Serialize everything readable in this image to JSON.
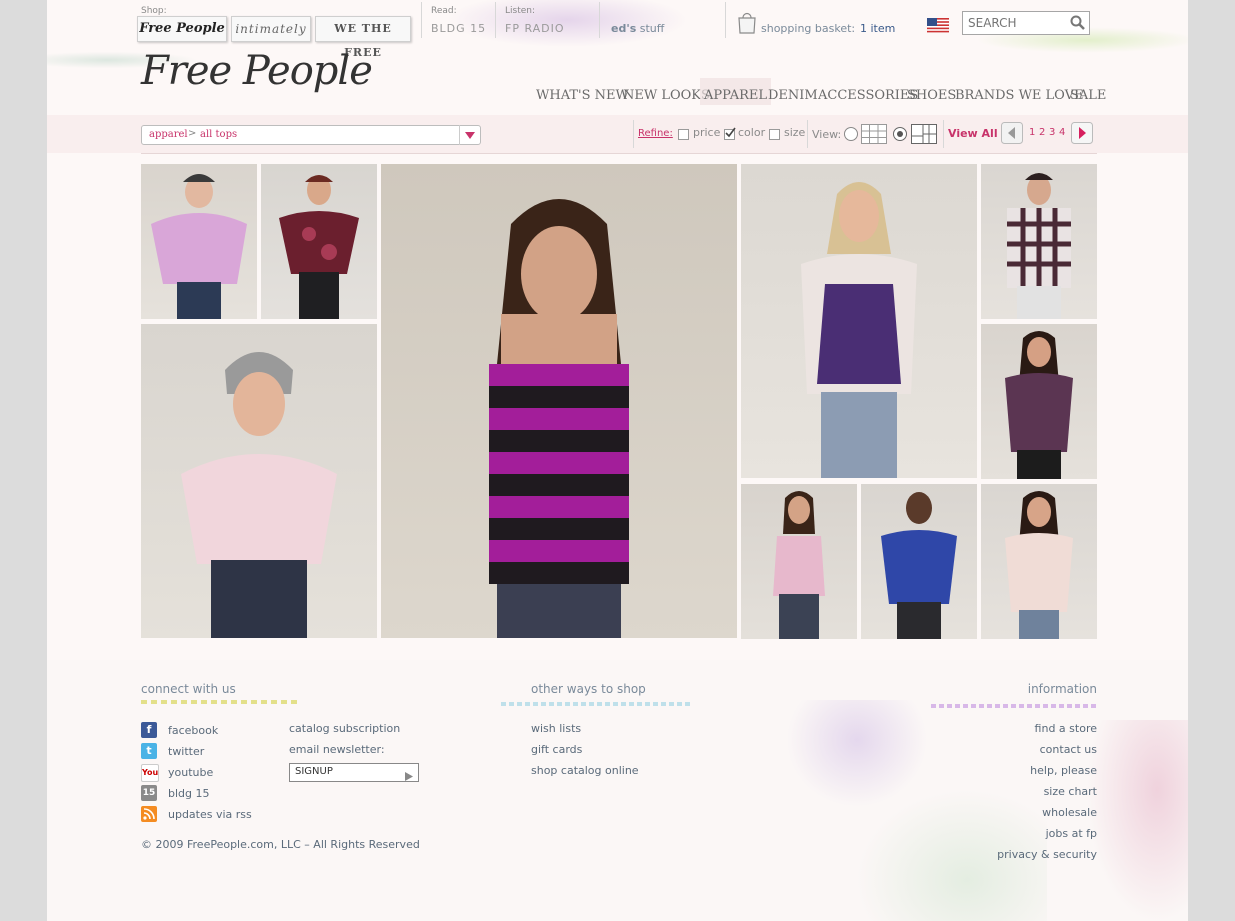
{
  "header": {
    "shop_label": "Shop:",
    "shop_buttons": [
      "Free People",
      "intimately",
      "WE THE FREE"
    ],
    "read_label": "Read:",
    "read_link": "BLDG 15",
    "listen_label": "Listen:",
    "listen_link": "FP RADIO",
    "eds_stuff_bold": "ed's",
    "eds_stuff_rest": "stuff",
    "basket_label": "shopping basket:",
    "basket_count": "1 item",
    "search_placeholder": "SEARCH",
    "logo": "Free People"
  },
  "nav": [
    "WHAT'S NEW",
    "NEW LOOKS",
    "APPAREL",
    "DENIM",
    "ACCESSORIES",
    "SHOES",
    "BRANDS WE LOVE",
    "SALE"
  ],
  "toolbar": {
    "breadcrumb_1": "apparel",
    "breadcrumb_sep": ">",
    "breadcrumb_2": "all tops",
    "refine_label": "Refine:",
    "refine_price": "price",
    "refine_color": "color",
    "refine_size": "size",
    "view_label": "View:",
    "view_all": "View All",
    "pages": [
      "1",
      "2",
      "3",
      "4"
    ]
  },
  "footer": {
    "connect_title": "connect with us",
    "social": [
      "facebook",
      "twitter",
      "youtube",
      "bldg 15",
      "updates via rss"
    ],
    "social_icons": [
      "facebook-icon",
      "twitter-icon",
      "youtube-icon",
      "bldg15-icon",
      "rss-icon"
    ],
    "catalog_subscription": "catalog subscription",
    "email_newsletter": "email newsletter:",
    "signup": "SIGNUP",
    "other_title": "other ways to shop",
    "other_links": [
      "wish lists",
      "gift cards",
      "shop catalog online"
    ],
    "info_title": "information",
    "info_links": [
      "find a store",
      "contact us",
      "help, please",
      "size chart",
      "wholesale",
      "jobs at fp",
      "privacy & security"
    ],
    "copyright": "© 2009 FreePeople.com, LLC – All Rights Reserved"
  },
  "colors": {
    "accent_pink": "#c8336a",
    "nav_grey": "#6a6a6a",
    "footer_link": "#5a6a7a"
  }
}
